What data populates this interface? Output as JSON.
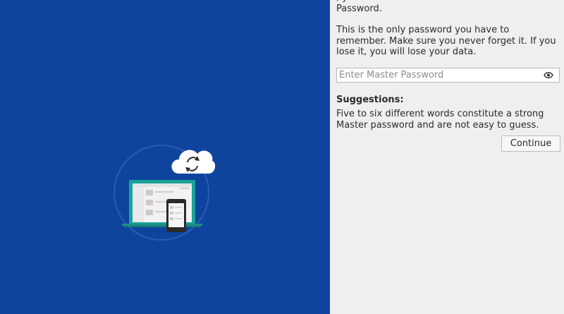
{
  "intro": {
    "tail": "                                      , y\nPassword."
  },
  "warning": "This is the only password you have to remember. Make sure you never forget it. If you lose it, you will lose your data.",
  "password_field": {
    "placeholder": "Enter Master Password",
    "value": "",
    "reveal_icon": "eye-icon"
  },
  "suggestions": {
    "heading": "Suggestions:",
    "body": "Five to six different words constitute a strong Master password and are not easy to guess."
  },
  "continue_label": "Continue",
  "illustration": {
    "cloud_icon": "cloud-sync-icon",
    "colors": {
      "background": "#0e449e",
      "laptop_screen": "#1aa39a",
      "cloud": "#ffffff"
    }
  }
}
